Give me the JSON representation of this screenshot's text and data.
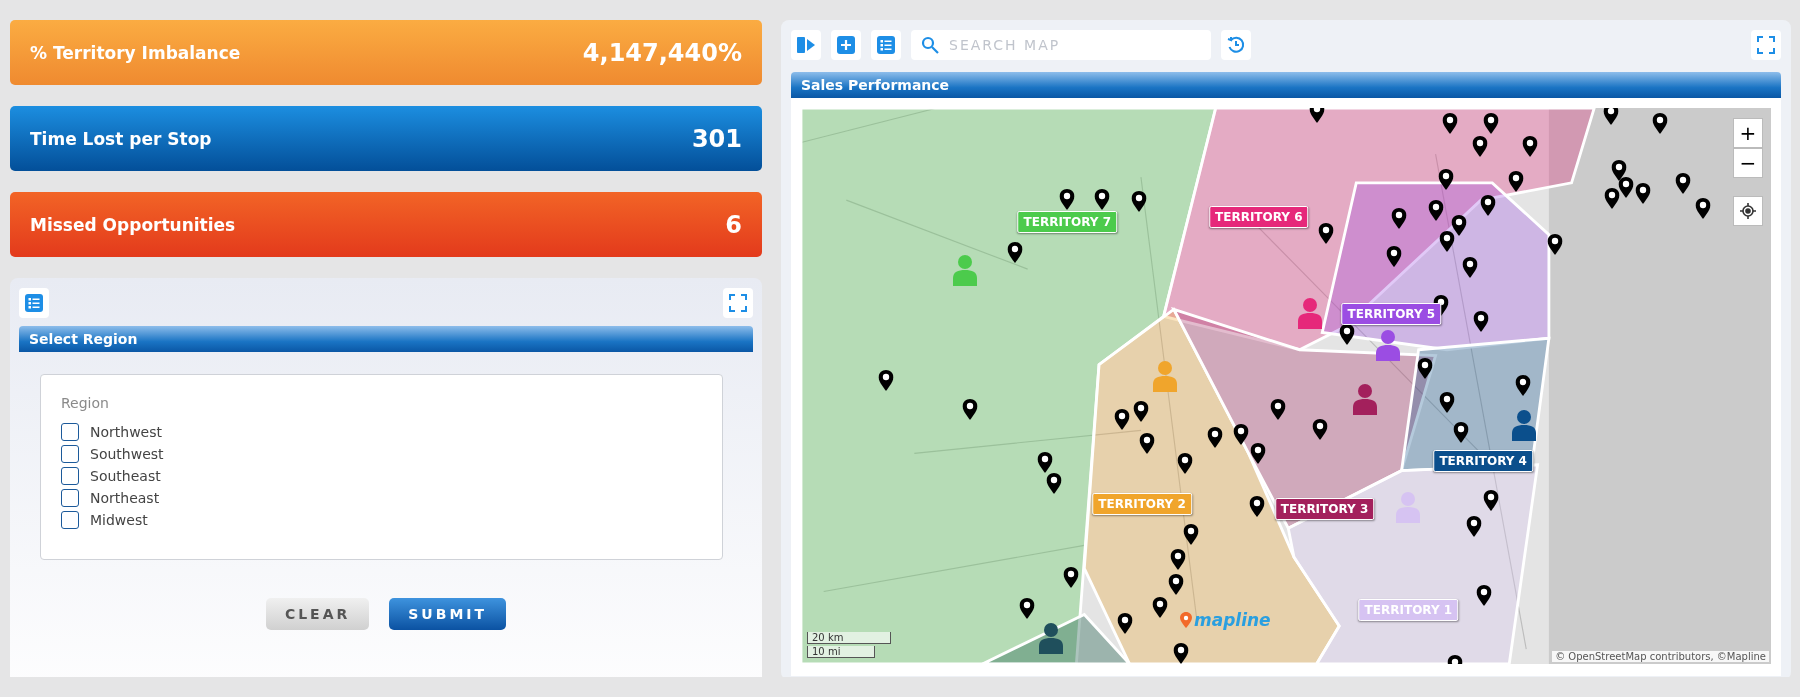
{
  "kpi_cards": [
    {
      "label": "% Territory Imbalance",
      "value": "4,147,440%",
      "kind": "orange"
    },
    {
      "label": "Time Lost per Stop",
      "value": "301",
      "kind": "blue"
    },
    {
      "label": "Missed Opportunities",
      "value": "6",
      "kind": "red"
    }
  ],
  "region_panel": {
    "title": "Select Region",
    "field_label": "Region",
    "options": [
      {
        "label": "Northwest",
        "checked": false
      },
      {
        "label": "Southwest",
        "checked": false
      },
      {
        "label": "Southeast",
        "checked": false
      },
      {
        "label": "Northeast",
        "checked": false
      },
      {
        "label": "Midwest",
        "checked": false
      }
    ],
    "buttons": [
      {
        "label": "CLEAR",
        "kind": "secondary"
      },
      {
        "label": "SUBMIT",
        "kind": "primary"
      }
    ]
  },
  "map_panel": {
    "search": {
      "placeholder": "SEARCH MAP"
    },
    "title": "Sales Performance",
    "territories": [
      {
        "label": "TERRITORY 7",
        "color": "#4ccb4c"
      },
      {
        "label": "TERRITORY 6",
        "color": "#e6287a"
      },
      {
        "label": "TERRITORY 5",
        "color": "#9b4de3"
      },
      {
        "label": "TERRITORY 2",
        "color": "#f0a52c"
      },
      {
        "label": "TERRITORY 3",
        "color": "#a3205c"
      },
      {
        "label": "TERRITORY 4",
        "color": "#0b4f8c"
      },
      {
        "label": "TERRITORY 1",
        "color": "#d6c3f2"
      }
    ],
    "zoom_in": "+",
    "zoom_out": "−",
    "scale": [
      "20 km",
      "10 mi"
    ],
    "logo": "mapline",
    "attribution": "© OpenStreetMap contributors, ©Mapline"
  }
}
